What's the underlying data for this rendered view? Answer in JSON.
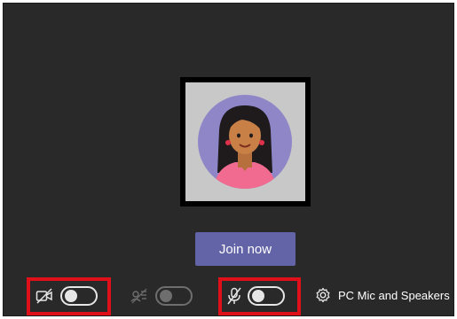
{
  "join_button": {
    "label": "Join now"
  },
  "controls": {
    "camera": {
      "icon": "camera-off-icon",
      "state": "off"
    },
    "background": {
      "icon": "background-blur-icon",
      "state": "disabled"
    },
    "microphone": {
      "icon": "microphone-off-icon",
      "state": "off"
    },
    "device_settings": {
      "icon": "gear-icon",
      "label": "PC Mic and Speakers"
    }
  },
  "colors": {
    "background": "#292929",
    "accent": "#6264a7",
    "highlight": "#e0101a"
  }
}
